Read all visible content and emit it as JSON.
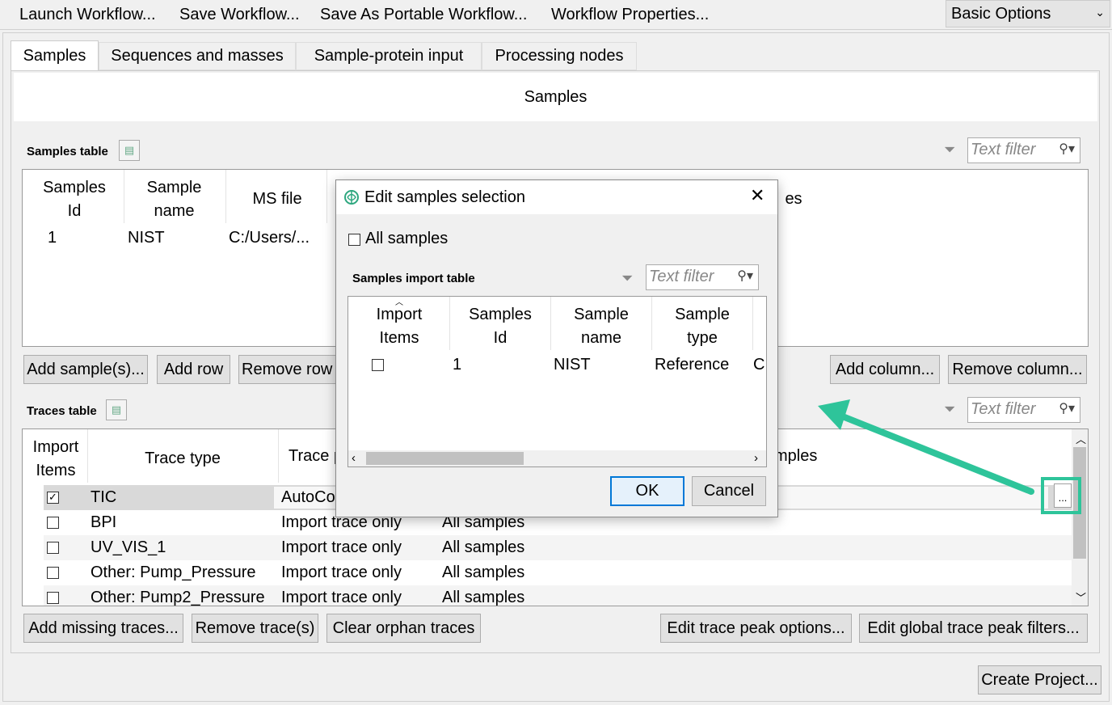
{
  "toolbar": {
    "launch": "Launch Workflow...",
    "save": "Save Workflow...",
    "save_as_portable": "Save As Portable Workflow...",
    "properties": "Workflow Properties...",
    "options_select": "Basic Options"
  },
  "tabs": [
    "Samples",
    "Sequences and masses",
    "Sample-protein input",
    "Processing nodes"
  ],
  "section_title": "Samples",
  "samples_table": {
    "title": "Samples table",
    "filter_placeholder": "Text filter",
    "headers": [
      "Samples\nId",
      "Sample\nname",
      "MS file",
      "es"
    ],
    "rows": [
      [
        "1",
        "NIST",
        "C:/Users/..."
      ]
    ],
    "buttons": {
      "add_samples": "Add sample(s)...",
      "add_row": "Add row",
      "remove_row": "Remove row",
      "add_column": "Add column...",
      "remove_column": "Remove column..."
    }
  },
  "traces_table": {
    "title": "Traces table",
    "filter_placeholder": "Text filter",
    "headers": [
      "Import\nItems",
      "Trace type",
      "Trace p",
      "mples"
    ],
    "rows": [
      {
        "checked": true,
        "type": "TIC",
        "processing": "AutoCo",
        "samples": ""
      },
      {
        "checked": false,
        "type": "BPI",
        "processing": "Import trace only",
        "samples": "All samples"
      },
      {
        "checked": false,
        "type": "UV_VIS_1",
        "processing": "Import trace only",
        "samples": "All samples"
      },
      {
        "checked": false,
        "type": "Other: Pump_Pressure",
        "processing": "Import trace only",
        "samples": "All samples"
      },
      {
        "checked": false,
        "type": "Other: Pump2_Pressure",
        "processing": "Import trace only",
        "samples": "All samples"
      }
    ],
    "ellipsis": "...",
    "buttons": {
      "add_missing": "Add missing traces...",
      "remove": "Remove trace(s)",
      "clear_orphan": "Clear orphan traces",
      "edit_peak": "Edit trace peak options...",
      "edit_global": "Edit global trace peak filters..."
    }
  },
  "create_project": "Create Project...",
  "dialog": {
    "title": "Edit samples selection",
    "all_samples": "All samples",
    "table_title": "Samples import table",
    "filter_placeholder": "Text filter",
    "headers": [
      "Import\nItems",
      "Samples\nId",
      "Sample\nname",
      "Sample\ntype"
    ],
    "rows": [
      {
        "checked": false,
        "id": "1",
        "name": "NIST",
        "type": "Reference",
        "extra": "C:"
      }
    ],
    "ok": "OK",
    "cancel": "Cancel"
  },
  "colors": {
    "highlight_box": "#2ec49a",
    "arrow": "#2ec49a",
    "ok_border": "#0078d7"
  }
}
